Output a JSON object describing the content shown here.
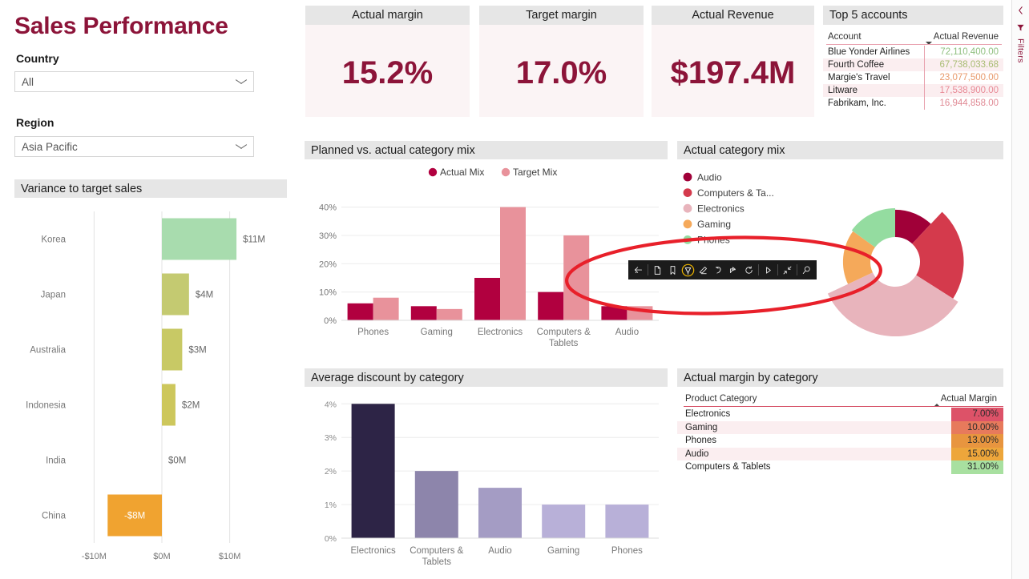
{
  "report": {
    "title": "Sales Performance"
  },
  "slicers": [
    {
      "label": "Country",
      "value": "All",
      "icon": "chevron-down-icon"
    },
    {
      "label": "Region",
      "value": "Asia Pacific",
      "icon": "chevron-down-icon"
    }
  ],
  "kpis": [
    {
      "title": "Actual margin",
      "value": "15.2%"
    },
    {
      "title": "Target margin",
      "value": "17.0%"
    },
    {
      "title": "Actual Revenue",
      "value": "$197.4M"
    }
  ],
  "top_accounts": {
    "title": "Top 5 accounts",
    "columns": [
      "Account",
      "Actual Revenue"
    ],
    "sort_column": "Actual Revenue",
    "sort_direction": "desc",
    "rows": [
      {
        "account": "Blue Yonder Airlines",
        "revenue": "72,110,400.00",
        "value_color": "#8fbf7f",
        "row_bg": "#ffffff"
      },
      {
        "account": "Fourth Coffee",
        "revenue": "67,738,033.68",
        "value_color": "#a8bc72",
        "row_bg": "#fbeef0"
      },
      {
        "account": "Margie's Travel",
        "revenue": "23,077,500.00",
        "value_color": "#e8996b",
        "row_bg": "#ffffff"
      },
      {
        "account": "Litware",
        "revenue": "17,538,900.00",
        "value_color": "#e88a96",
        "row_bg": "#fbeef0"
      },
      {
        "account": "Fabrikam, Inc.",
        "revenue": "16,944,858.00",
        "value_color": "#e08a95",
        "row_bg": "#ffffff"
      }
    ]
  },
  "margin_table": {
    "title": "Actual margin by category",
    "columns": [
      "Product Category",
      "Actual Margin"
    ],
    "sort_column": "Actual Margin",
    "sort_direction": "asc",
    "rows": [
      {
        "category": "Electronics",
        "margin": "7.00%",
        "cell_bg": "#dd5268",
        "row_bg": "#ffffff"
      },
      {
        "category": "Gaming",
        "margin": "10.00%",
        "cell_bg": "#e77a5c",
        "row_bg": "#fbeef0"
      },
      {
        "category": "Phones",
        "margin": "13.00%",
        "cell_bg": "#e8953f",
        "row_bg": "#ffffff"
      },
      {
        "category": "Audio",
        "margin": "15.00%",
        "cell_bg": "#eda63b",
        "row_bg": "#fbeef0"
      },
      {
        "category": "Computers & Tablets",
        "margin": "31.00%",
        "cell_bg": "#a8e0a0",
        "row_bg": "#ffffff"
      }
    ]
  },
  "annotation": {
    "ellipse_color": "#e8202a",
    "toolbar": [
      {
        "name": "back-icon",
        "active": false
      },
      {
        "name": "page-icon",
        "active": false
      },
      {
        "name": "bookmark-icon",
        "active": false
      },
      {
        "name": "highlighter-pen-icon",
        "active": true
      },
      {
        "name": "eraser-icon",
        "active": false
      },
      {
        "name": "undo-icon",
        "active": false
      },
      {
        "name": "share-icon",
        "active": false
      },
      {
        "name": "reset-icon",
        "active": false
      },
      {
        "name": "play-icon",
        "active": false
      },
      {
        "name": "shrink-icon",
        "active": false
      },
      {
        "name": "zoom-icon",
        "active": false
      }
    ]
  },
  "filters_pane": {
    "label": "Filters",
    "expand_icon": "chevron-left-icon",
    "funnel_icon": "filter-funnel-icon"
  },
  "chart_data": [
    {
      "id": "variance",
      "type": "bar",
      "orientation": "horizontal",
      "title": "Variance to target sales",
      "categories": [
        "Korea",
        "Japan",
        "Australia",
        "Indonesia",
        "India",
        "China"
      ],
      "values": [
        11,
        4,
        3,
        2,
        0,
        -8
      ],
      "data_labels": [
        "$11M",
        "$4M",
        "$3M",
        "$2M",
        "$0M",
        "-$8M"
      ],
      "colors": [
        "#a8dcae",
        "#c4ca71",
        "#c8c965",
        "#cdc75c",
        "#d9c34f",
        "#f0a330"
      ],
      "xlabel": "",
      "ylabel": "",
      "xlim": [
        -13,
        13
      ],
      "xticks": [
        -10,
        0,
        10
      ],
      "xtick_labels": [
        "-$10M",
        "$0M",
        "$10M"
      ],
      "grid": true,
      "unit": "$M"
    },
    {
      "id": "planned_vs_actual",
      "type": "bar",
      "title": "Planned vs. actual category mix",
      "categories": [
        "Phones",
        "Gaming",
        "Electronics",
        "Computers & Tablets",
        "Audio"
      ],
      "series": [
        {
          "name": "Actual Mix",
          "color": "#b1003f",
          "values": [
            6,
            5,
            15,
            10,
            5
          ]
        },
        {
          "name": "Target Mix",
          "color": "#e8929b",
          "values": [
            8,
            4,
            40,
            30,
            5
          ]
        }
      ],
      "ylim": [
        0,
        43
      ],
      "yticks": [
        0,
        10,
        20,
        30,
        40
      ],
      "ytick_labels": [
        "0%",
        "10%",
        "20%",
        "30%",
        "40%"
      ],
      "legend_position": "top",
      "grid": true
    },
    {
      "id": "actual_category_mix",
      "type": "pie",
      "variant": "variable-radius-donut",
      "title": "Actual category mix",
      "legend_position": "left",
      "slices": [
        {
          "label": "Audio",
          "color": "#a00038",
          "share": 12,
          "radius_pct": 55
        },
        {
          "label": "Computers & Ta...",
          "full_label": "Computers & Tablets",
          "color": "#d43a4c",
          "share": 22,
          "radius_pct": 88
        },
        {
          "label": "Electronics",
          "color": "#e8b4bc",
          "share": 34,
          "radius_pct": 100
        },
        {
          "label": "Gaming",
          "color": "#f5a95a",
          "share": 17,
          "radius_pct": 55
        },
        {
          "label": "Phones",
          "color": "#94dca0",
          "share": 15,
          "radius_pct": 58
        }
      ]
    },
    {
      "id": "avg_discount",
      "type": "bar",
      "title": "Average discount by category",
      "categories": [
        "Electronics",
        "Computers & Tablets",
        "Audio",
        "Gaming",
        "Phones"
      ],
      "values": [
        4.0,
        2.0,
        1.5,
        1.0,
        1.0
      ],
      "colors": [
        "#2d2446",
        "#8d85ab",
        "#a49cc4",
        "#b8b0d8",
        "#b8b0d8"
      ],
      "ylim": [
        0,
        4.15
      ],
      "yticks": [
        0,
        1,
        2,
        3,
        4
      ],
      "ytick_labels": [
        "0%",
        "1%",
        "2%",
        "3%",
        "4%"
      ],
      "grid": true
    }
  ]
}
